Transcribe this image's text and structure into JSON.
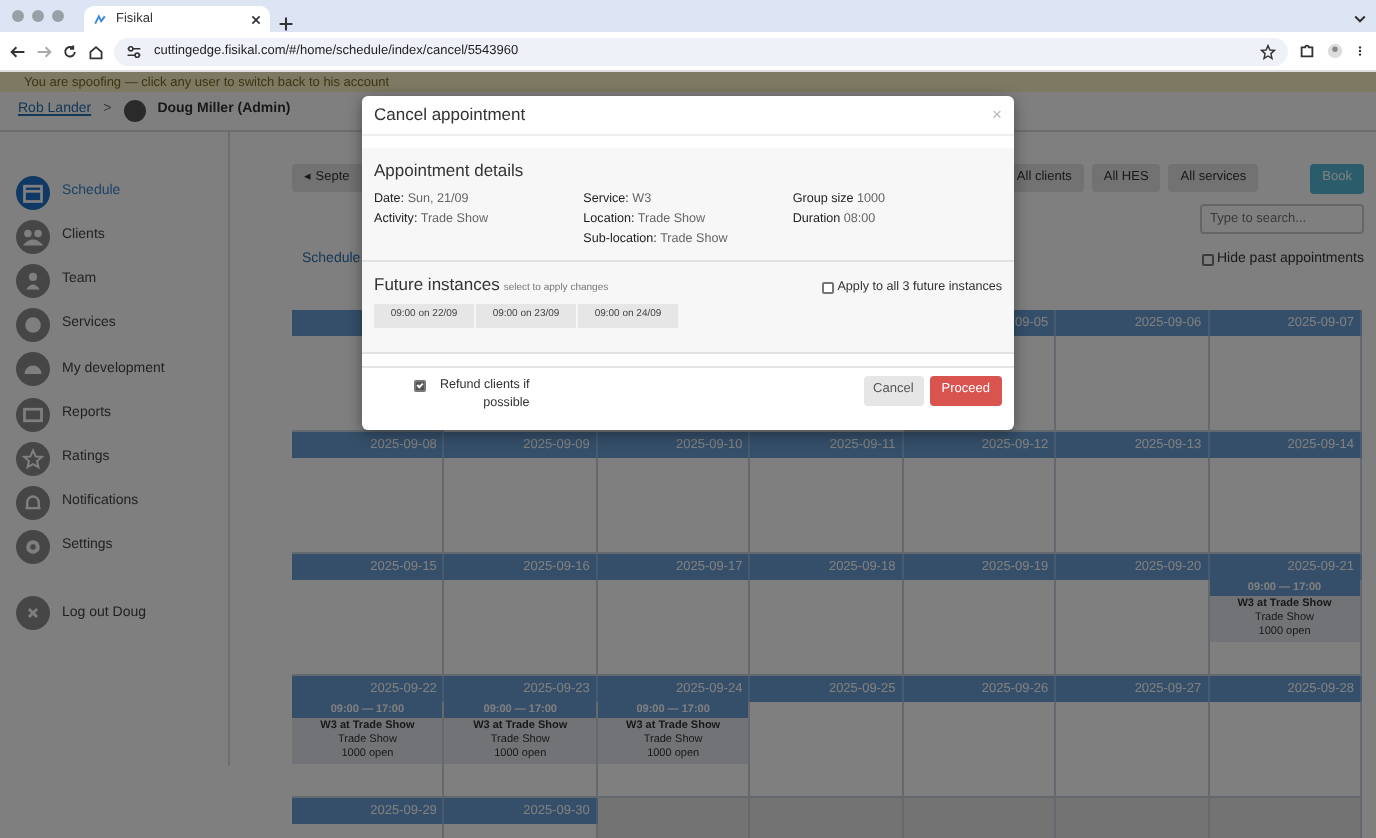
{
  "browser": {
    "tab_title": "Fisikal",
    "url": "cuttingedge.fisikal.com/#/home/schedule/index/cancel/5543960"
  },
  "spoof_banner": "You are spoofing — click any user to switch back to his account",
  "breadcrumb": {
    "link": "Rob Lander",
    "separator": ">",
    "user": "Doug Miller (Admin)"
  },
  "sidebar": {
    "items": [
      {
        "label": "Schedule",
        "selected": true
      },
      {
        "label": "Clients",
        "selected": false
      },
      {
        "label": "Team",
        "selected": false
      },
      {
        "label": "Services",
        "selected": false
      },
      {
        "label": "My development",
        "selected": false
      },
      {
        "label": "Reports",
        "selected": false
      },
      {
        "label": "Ratings",
        "selected": false
      },
      {
        "label": "Notifications",
        "selected": false
      },
      {
        "label": "Settings",
        "selected": false
      }
    ],
    "logout": "Log out Doug"
  },
  "toolbar": {
    "prev": "◂",
    "month": "Septe",
    "filters": [
      "All clients",
      "All HES",
      "All services"
    ],
    "book": "Book",
    "search_placeholder": "Type to search...",
    "schedule_link": "Schedule",
    "hide_past": {
      "label": "Hide past appointments",
      "checked": false
    }
  },
  "calendar": {
    "weeks": [
      {
        "days": [
          {
            "kind": "day"
          },
          {
            "kind": "covered"
          },
          {
            "kind": "covered"
          },
          {
            "kind": "covered"
          },
          {
            "kind": "day",
            "date": "09-05"
          },
          {
            "kind": "day",
            "date": "2025-09-06"
          },
          {
            "kind": "day",
            "date": "2025-09-07"
          }
        ]
      },
      {
        "days": [
          {
            "kind": "day",
            "date": "2025-09-08"
          },
          {
            "kind": "day",
            "date": "2025-09-09"
          },
          {
            "kind": "day",
            "date": "2025-09-10"
          },
          {
            "kind": "day",
            "date": "2025-09-11"
          },
          {
            "kind": "day",
            "date": "2025-09-12"
          },
          {
            "kind": "day",
            "date": "2025-09-13"
          },
          {
            "kind": "day",
            "date": "2025-09-14"
          }
        ]
      },
      {
        "days": [
          {
            "kind": "day",
            "date": "2025-09-15"
          },
          {
            "kind": "day",
            "date": "2025-09-16"
          },
          {
            "kind": "day",
            "date": "2025-09-17"
          },
          {
            "kind": "day",
            "date": "2025-09-18"
          },
          {
            "kind": "day",
            "date": "2025-09-19"
          },
          {
            "kind": "day",
            "date": "2025-09-20"
          },
          {
            "kind": "day",
            "date": "2025-09-21",
            "events": [
              {
                "time": "09:00 — 17:00",
                "title": "W3 at Trade Show",
                "location": "Trade Show",
                "spaces": "1000 open"
              }
            ]
          }
        ]
      },
      {
        "days": [
          {
            "kind": "day",
            "date": "2025-09-22",
            "events": [
              {
                "time": "09:00 — 17:00",
                "title": "W3 at Trade Show",
                "location": "Trade Show",
                "spaces": "1000 open"
              }
            ]
          },
          {
            "kind": "day",
            "date": "2025-09-23",
            "events": [
              {
                "time": "09:00 — 17:00",
                "title": "W3 at Trade Show",
                "location": "Trade Show",
                "spaces": "1000 open"
              }
            ]
          },
          {
            "kind": "day",
            "date": "2025-09-24",
            "events": [
              {
                "time": "09:00 — 17:00",
                "title": "W3 at Trade Show",
                "location": "Trade Show",
                "spaces": "1000 open"
              }
            ]
          },
          {
            "kind": "day",
            "date": "2025-09-25"
          },
          {
            "kind": "day",
            "date": "2025-09-26"
          },
          {
            "kind": "day",
            "date": "2025-09-27"
          },
          {
            "kind": "day",
            "date": "2025-09-28"
          }
        ]
      },
      {
        "days": [
          {
            "kind": "day",
            "date": "2025-09-29"
          },
          {
            "kind": "day",
            "date": "2025-09-30"
          },
          {
            "kind": "blank"
          },
          {
            "kind": "blank"
          },
          {
            "kind": "blank"
          },
          {
            "kind": "blank"
          },
          {
            "kind": "blank"
          }
        ]
      }
    ]
  },
  "modal": {
    "title": "Cancel appointment",
    "close": "×",
    "details_heading": "Appointment details",
    "details": [
      [
        {
          "label": "Date:",
          "value": "Sun, 21/09"
        },
        {
          "label": "Activity:",
          "value": "Trade Show"
        }
      ],
      [
        {
          "label": "Service:",
          "value": "W3"
        },
        {
          "label": "Location:",
          "value": "Trade Show"
        },
        {
          "label": "Sub-location:",
          "value": "Trade Show"
        }
      ],
      [
        {
          "label": "Group size",
          "value": "1000"
        },
        {
          "label": "Duration",
          "value": "08:00"
        }
      ]
    ],
    "future_heading": "Future instances",
    "future_hint": "select to apply changes",
    "apply_all": {
      "label": "Apply to all 3 future instances",
      "checked": false
    },
    "instances": [
      {
        "label": "09:00 on 22/09",
        "selected": false
      },
      {
        "label": "09:00 on 23/09",
        "selected": false
      },
      {
        "label": "09:00 on 24/09",
        "selected": false
      }
    ],
    "refund": {
      "label": "Refund clients if possible",
      "checked": true
    },
    "cancel": "Cancel",
    "proceed": "Proceed"
  }
}
